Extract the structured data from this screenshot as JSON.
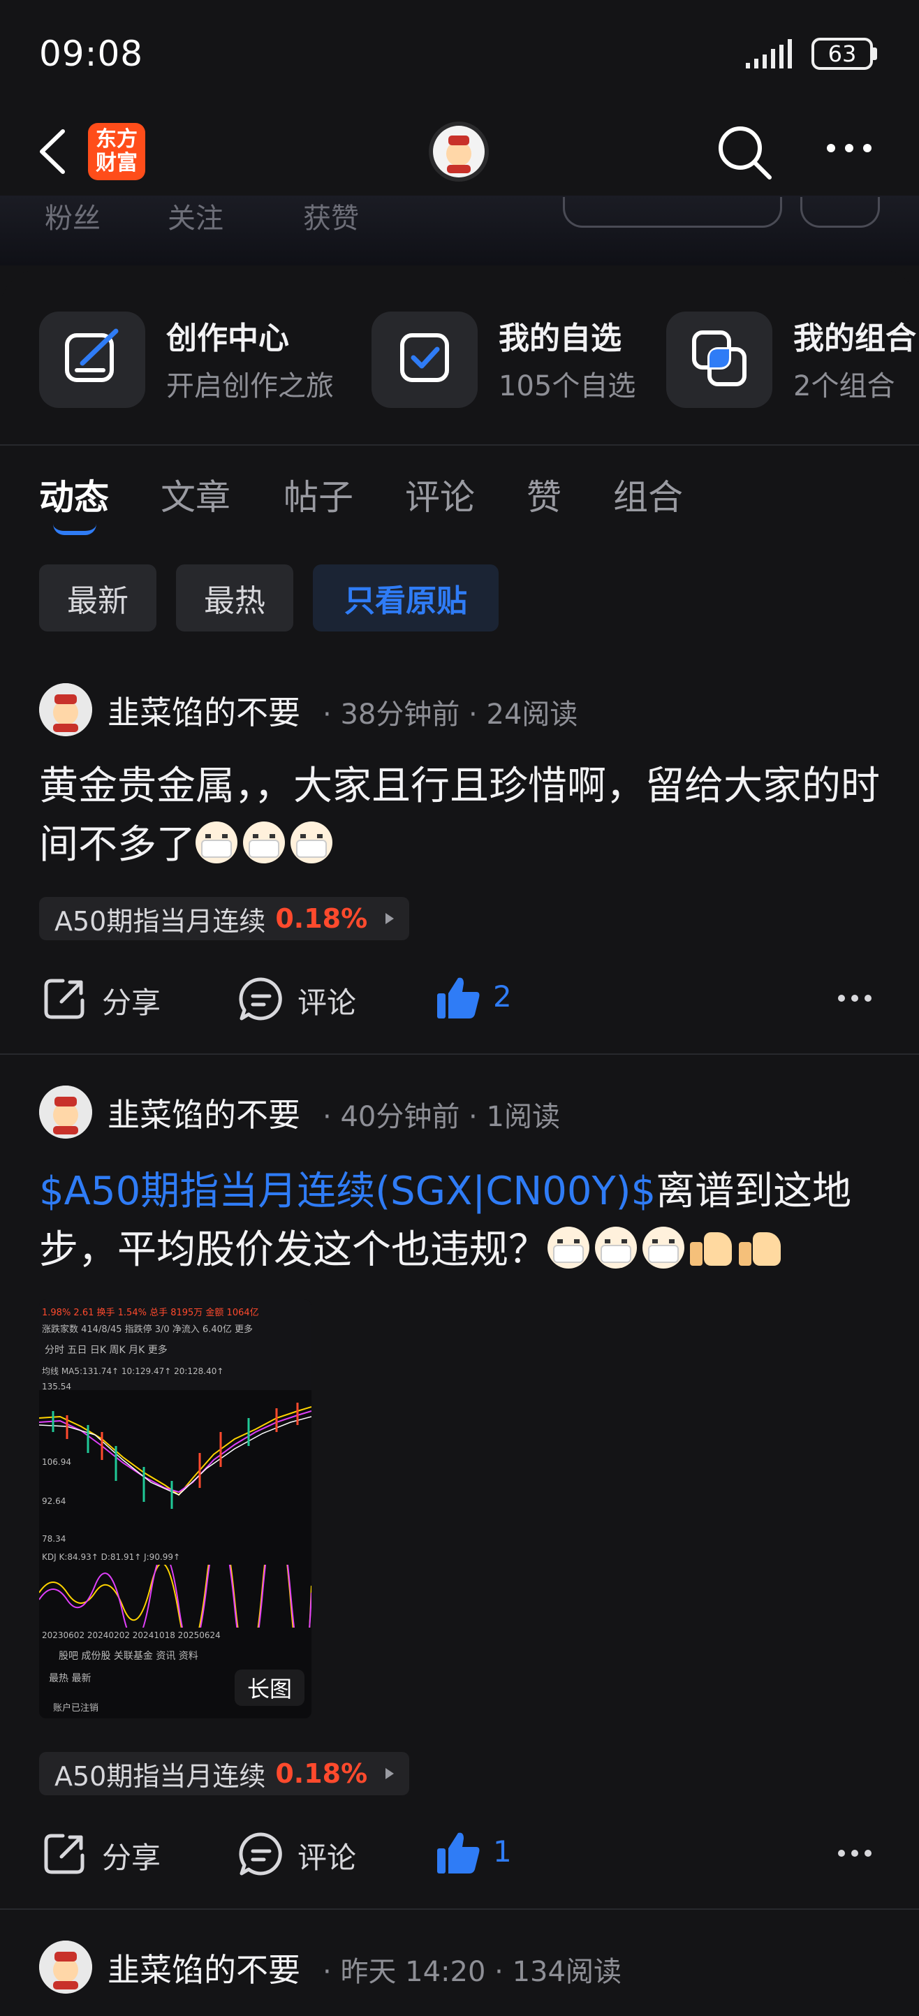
{
  "status": {
    "time": "09:08",
    "battery": "63"
  },
  "nav": {
    "brand_line1": "东方",
    "brand_line2": "财富"
  },
  "bg_header": {
    "stats": [
      "粉丝",
      "关注",
      "获赞"
    ]
  },
  "cards": [
    {
      "title": "创作中心",
      "sub": "开启创作之旅",
      "icon": "edit-icon"
    },
    {
      "title": "我的自选",
      "sub": "105个自选",
      "icon": "checkbox-icon"
    },
    {
      "title": "我的组合",
      "sub": "2个组合",
      "icon": "portfolio-icon"
    }
  ],
  "tabs": [
    "动态",
    "文章",
    "帖子",
    "评论",
    "赞",
    "组合"
  ],
  "filters": [
    "最新",
    "最热",
    "只看原贴"
  ],
  "posts": [
    {
      "author": "韭菜馅的不要",
      "time": "38分钟前",
      "reads": "24阅读",
      "text": "黄金贵金属，，大家且行且珍惜啊，留给大家的时间不多了",
      "tag_name": "A50期指当月连续",
      "tag_pct": "0.18%",
      "share": "分享",
      "comment": "评论",
      "likes": "2"
    },
    {
      "author": "韭菜馅的不要",
      "time": "40分钟前",
      "reads": "1阅读",
      "link": "$A50期指当月连续(SGX|CN00Y)$",
      "text": "离谱到这地步，平均股价发这个也违规？",
      "image_badge": "长图",
      "tag_name": "A50期指当月连续",
      "tag_pct": "0.18%",
      "share": "分享",
      "comment": "评论",
      "likes": "1"
    },
    {
      "author": "韭菜馅的不要",
      "time": "昨天 14:20",
      "reads": "134阅读"
    }
  ],
  "chart_image": {
    "row1": "1.98%  2.61  换手  1.54%  总手  8195万  金额  1064亿",
    "row2": "涨跌家数  414/8/45  指跌停  3/0  净流入  6.40亿  更多",
    "periods": "分时  五日  日K  周K  月K  更多",
    "ma_line": "均线  MA5:131.74↑ 10:129.47↑ 20:128.40↑",
    "kdj_line": "KDJ  K:84.93↑  D:81.91↑  J:90.99↑",
    "y1": "135.54",
    "y2": "106.94",
    "y3": "92.64",
    "y4": "78.34",
    "dates": "20230602   20240202   20241018   20250624",
    "bottom_tabs": "股吧   成份股   关联基金   资讯   资料",
    "bottom_sort": "最热   最新",
    "bottom_user": "账户已注销"
  },
  "colors": {
    "accent": "#2f7cf6",
    "up": "#ff4a2d",
    "brand": "#ff4d1a"
  }
}
